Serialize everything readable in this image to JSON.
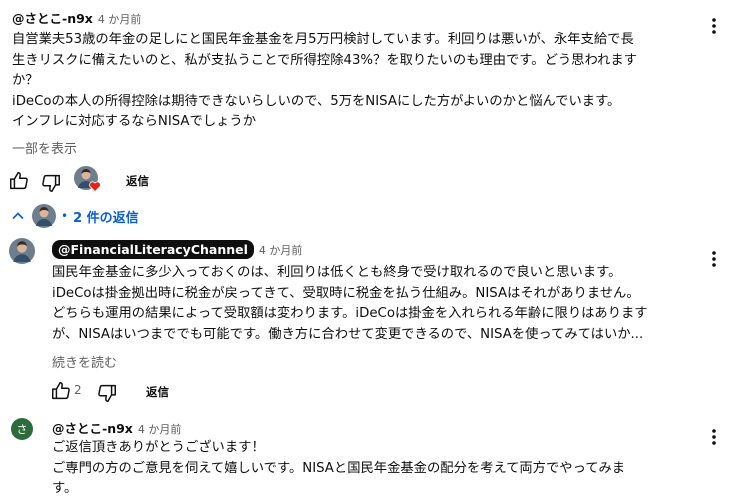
{
  "comment1": {
    "author": "@さとこ-n9x",
    "time": "4 か月前",
    "lines": [
      "自営業夫53歳の年金の足しにと国民年金基金を月5万円検討しています。利回りは悪いが、永年支給で長",
      "生きリスクに備えたいのと、私が支払うことで所得控除43%？を取りたいのも理由です。どう思われます",
      "か？",
      "iDeCoの本人の所得控除は期待できないらしいので、5万をNISAにした方がよいのかと悩んでいます。",
      "インフレに対応するならNISAでしょうか"
    ],
    "show_more": "一部を表示",
    "reply_label": "返信"
  },
  "replies_toggle": {
    "label": "2 件の返信",
    "color": "#065fd4"
  },
  "reply1": {
    "author": "@FinancialLiteracyChannel",
    "time": "4 か月前",
    "lines": [
      "国民年金基金に多少入っておくのは、利回りは低くとも終身で受け取れるので良いと思います。",
      "iDeCoは掛金拠出時に税金が戻ってきて、受取時に税金を払う仕組み。NISAはそれがありません。",
      "どちらも運用の結果によって受取額は変わります。iDeCoは掛金を入れられる年齢に限りはあります",
      "が、NISAはいつまででも可能です。働き方に合わせて変更できるので、NISAを使ってみてはいか..."
    ],
    "read_more": "続きを読む",
    "like_count": "2",
    "reply_label": "返信"
  },
  "reply2": {
    "avatar_letter": "さ",
    "avatar_color": "#2e6b3a",
    "author": "@さとこ-n9x",
    "time": "4 か月前",
    "lines": [
      "ご返信頂きありがとうございます！",
      "ご専門の方のご意見を伺えて嬉しいです。NISAと国民年金基金の配分を考えて両方でやってみま",
      "す。"
    ]
  },
  "icons": {
    "like": "thumbs-up-icon",
    "dislike": "thumbs-down-icon",
    "more": "more-vert-icon",
    "expand": "chevron-up-icon",
    "heart": "heart-icon"
  }
}
